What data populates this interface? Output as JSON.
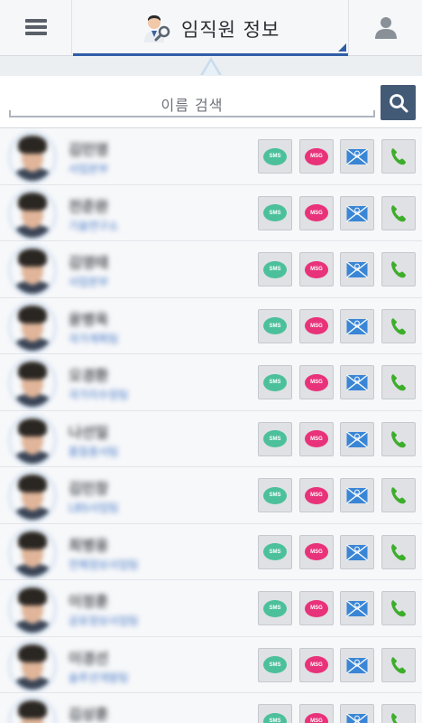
{
  "header": {
    "title": "임직원 정보",
    "menu_icon": "hamburger-menu-icon",
    "title_icon": "person-search-icon",
    "profile_icon": "user-profile-icon",
    "accent_color": "#2e5da6"
  },
  "search": {
    "placeholder": "이름 검색",
    "button_icon": "search-icon",
    "button_color": "#435a76"
  },
  "actions": {
    "sms_label": "SMS",
    "msg_label": "MSG",
    "mail_icon": "email-icon",
    "call_icon": "phone-icon",
    "sms_color": "#4cc09b",
    "msg_color": "#e8327a",
    "mail_color": "#3a86d6",
    "call_color": "#3dae2b"
  },
  "contacts": [
    {
      "name": "김민영",
      "dept": "사업본부"
    },
    {
      "name": "전준완",
      "dept": "기술연구소"
    },
    {
      "name": "김영태",
      "dept": "사업본부"
    },
    {
      "name": "윤병욱",
      "dept": "국가계획팀"
    },
    {
      "name": "오경환",
      "dept": "국가지수정팀"
    },
    {
      "name": "나선일",
      "dept": "품질총서팀"
    },
    {
      "name": "김민창",
      "dept": "LBS사업팀"
    },
    {
      "name": "최병웅",
      "dept": "전체정보사업팀"
    },
    {
      "name": "이정훈",
      "dept": "공유정보사업팀"
    },
    {
      "name": "이경선",
      "dept": "솔루션개발팀"
    },
    {
      "name": "김상훈",
      "dept": ""
    }
  ]
}
